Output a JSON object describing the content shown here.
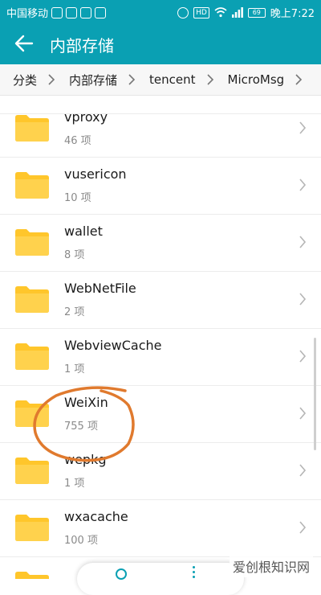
{
  "status_bar": {
    "carrier": "中国移动",
    "hd": "HD",
    "battery": "69",
    "time": "晚上7:22"
  },
  "app_bar": {
    "title": "内部存储"
  },
  "breadcrumb": [
    "分类",
    "内部存储",
    "tencent",
    "MicroMsg"
  ],
  "items": [
    {
      "name": "vproxy",
      "count": "46 项"
    },
    {
      "name": "vusericon",
      "count": "10 项"
    },
    {
      "name": "wallet",
      "count": "8 项"
    },
    {
      "name": "WebNetFile",
      "count": "2 项"
    },
    {
      "name": "WebviewCache",
      "count": "1 项"
    },
    {
      "name": "WeiXin",
      "count": "755 项"
    },
    {
      "name": "wepkg",
      "count": "1 项"
    },
    {
      "name": "wxacache",
      "count": "100 项"
    }
  ],
  "watermark": "爱创根知识网",
  "colors": {
    "accent": "#0aa0b3",
    "folder": "#ffc62b",
    "annotation": "#e07a2e"
  }
}
